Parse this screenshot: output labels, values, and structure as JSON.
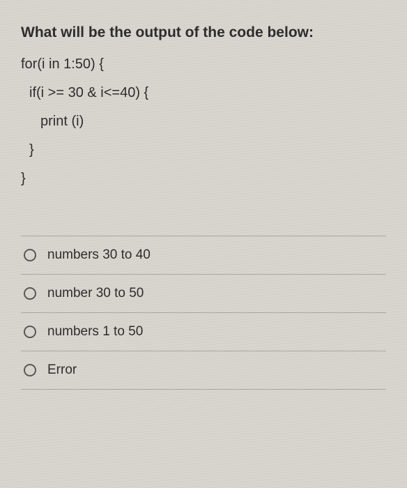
{
  "question": {
    "title": "What will be the output of the code below:",
    "code_lines": [
      "for(i in 1:50) {",
      "if(i >= 30 & i<=40) {",
      "print (i)",
      "}",
      "}"
    ]
  },
  "options": [
    {
      "label": "numbers 30 to 40"
    },
    {
      "label": "number 30 to 50"
    },
    {
      "label": "numbers 1 to 50"
    },
    {
      "label": "Error"
    }
  ]
}
